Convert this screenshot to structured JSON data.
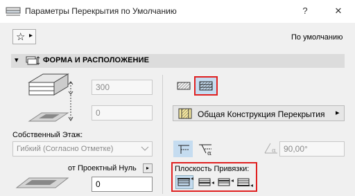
{
  "window": {
    "title": "Параметры Перекрытия по Умолчанию",
    "help_label": "?",
    "close_label": "✕"
  },
  "favorites": {
    "star_glyph": "☆",
    "arrow_glyph": "▸",
    "label": "По умолчанию"
  },
  "section": {
    "toggle_glyph": "▾",
    "title": "ФОРМА И РАСПОЛОЖЕНИЕ"
  },
  "geometry": {
    "thickness_value": "300",
    "offset_value": "0",
    "home_story_label": "Собственный Этаж:",
    "home_story_value": "Гибкий (Согласно Отметке)",
    "reference_label": "от Проектный Нуль",
    "reference_arrow": "▸",
    "reference_value": "0"
  },
  "structure": {
    "composite_name": "Общая Конструкция Перекрытия",
    "dropdown_arrow": "▸",
    "angle_value": "90,00°",
    "alpha_glyph": "α"
  },
  "reference_plane": {
    "label": "Плоскость Привязки:"
  },
  "colors": {
    "highlight": "#e02020",
    "selected_bg": "#c5dcf0",
    "section_bg": "#dcdcdc"
  }
}
